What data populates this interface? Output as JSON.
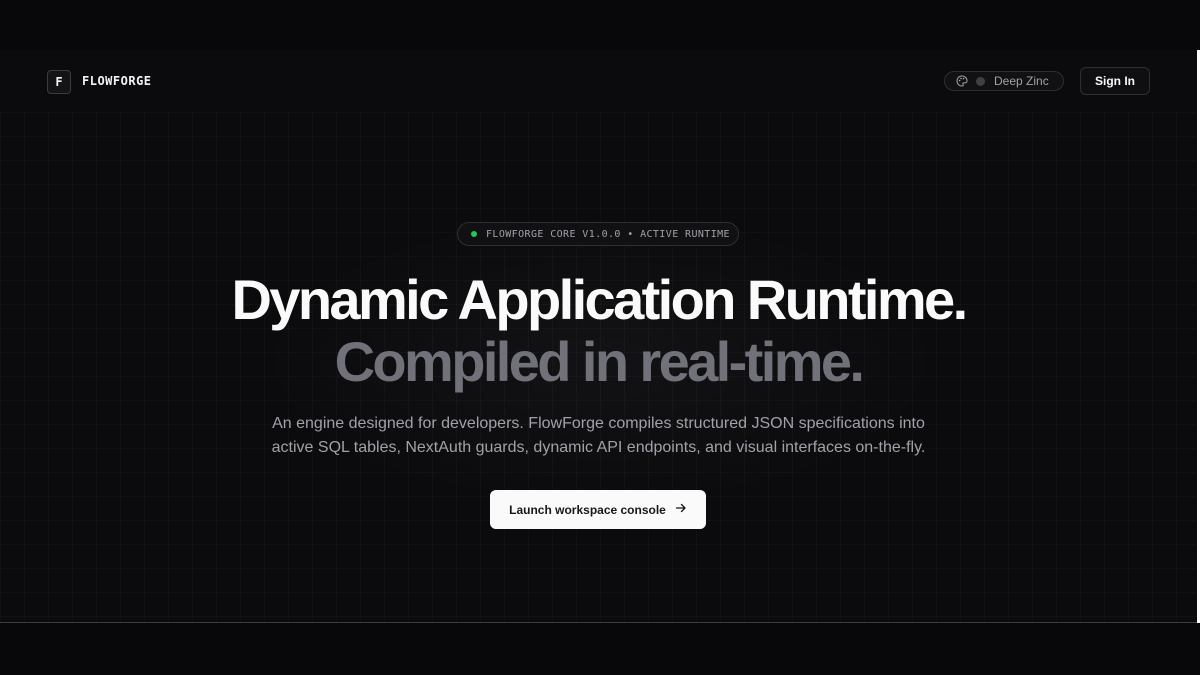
{
  "header": {
    "logo_letter": "F",
    "brand": "FLOWFORGE",
    "theme": {
      "icon": "palette-icon",
      "label": "Deep Zinc"
    },
    "signin_label": "Sign In"
  },
  "hero": {
    "badge": "FLOWFORGE CORE V1.0.0 • ACTIVE RUNTIME",
    "title_line1": "Dynamic Application Runtime.",
    "title_line2": "Compiled in real-time.",
    "subtitle_line1": "An engine designed for developers. FlowForge compiles structured JSON specifications into",
    "subtitle_line2": "active SQL tables, NextAuth guards, dynamic API endpoints, and visual interfaces on-the-fly.",
    "cta_label": "Launch workspace console",
    "cta_icon": "arrow-right-icon"
  },
  "colors": {
    "background": "#0b0b0d",
    "status_dot": "#22c55e",
    "accent_text": "#71717a",
    "cta_bg": "#fafafa"
  }
}
